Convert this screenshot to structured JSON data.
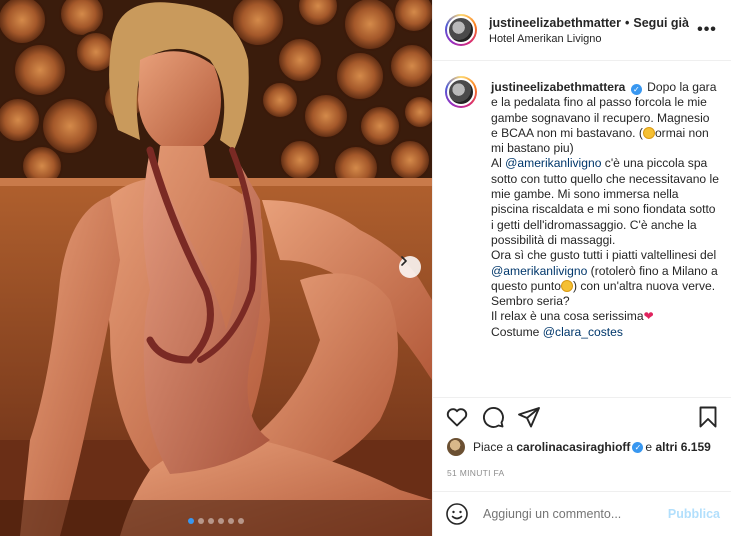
{
  "post": {
    "username": "justineelizabethmattera",
    "follow_separator": "•",
    "follow_label": "Segui già",
    "location": "Hotel Amerikan Livigno",
    "more_label": "•••"
  },
  "photo": {
    "alt_subject": "",
    "carousel": {
      "total": 6,
      "active_index": 0
    }
  },
  "caption": {
    "username": "justineelizabethmattera",
    "p1": "Dopo la gara e la pedalata fino al passo forcola le mie gambe sognavano il recupero. Magnesio e BCAA non mi bastavano. (",
    "p1b": "ormai non mi bastano piu)",
    "p2a": "Al ",
    "mention1": "@amerikanlivigno",
    "p2b": " c'è una piccola spa sotto con tutto quello che necessitavano le mie gambe. Mi sono immersa nella piscina riscaldata e mi sono fiondata sotto i getti dell'idromassaggio. C'è anche la possibilità di massaggi.",
    "p3a": "Ora sì che gusto tutti i piatti valtellinesi del ",
    "mention2": "@amerikanlivigno",
    "p3b": " (rotolerò fino a Milano a questo punto",
    "p3c": ") con un'altra nuova verve.",
    "p4": "Sembro seria?",
    "p5": "Il relax è una cosa serissima",
    "p6a": "Costume ",
    "mention3": "@clara_costes"
  },
  "likes": {
    "prefix": "Piace a ",
    "user": "carolinacasiraghioff",
    "middle": " e ",
    "others": "altri 6.159"
  },
  "timestamp": "51 MINUTI FA",
  "comment": {
    "placeholder": "Aggiungi un commento...",
    "publish_label": "Pubblica"
  },
  "colors": {
    "accent": "#3897f0",
    "mention": "#00376b",
    "publish_disabled": "#b2dffc"
  },
  "icons": {
    "like": "heart-icon",
    "comment": "comment-icon",
    "share": "send-icon",
    "save": "bookmark-icon",
    "emoji": "smiley-icon",
    "next": "chevron-right-icon"
  }
}
